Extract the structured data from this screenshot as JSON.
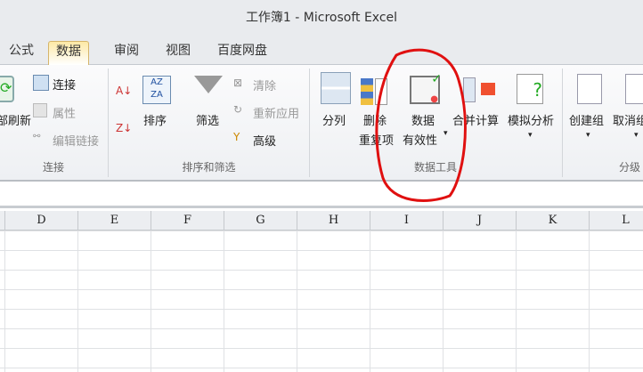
{
  "window": {
    "title": "工作簿1 - Microsoft Excel"
  },
  "tabs": [
    {
      "label": "公式"
    },
    {
      "label": "数据",
      "active": true
    },
    {
      "label": "审阅"
    },
    {
      "label": "视图"
    },
    {
      "label": "百度网盘"
    }
  ],
  "ribbon": {
    "connections": {
      "refresh": "部刷新",
      "connect": "连接",
      "properties": "属性",
      "edit_links": "编辑链接",
      "group": "连接"
    },
    "sort_filter": {
      "sort": "排序",
      "filter": "筛选",
      "clear": "清除",
      "reapply": "重新应用",
      "advanced": "高级",
      "group": "排序和筛选"
    },
    "data_tools": {
      "text_to_columns": "分列",
      "remove_dup_1": "删除",
      "remove_dup_2": "重复项",
      "validation_1": "数据",
      "validation_2": "有效性",
      "consolidate": "合并计算",
      "what_if": "模拟分析",
      "group": "数据工具"
    },
    "outline": {
      "group_btn": "创建组",
      "ungroup": "取消组合",
      "group": "分级"
    }
  },
  "columns": [
    "D",
    "E",
    "F",
    "G",
    "H",
    "I",
    "J",
    "K",
    "L"
  ],
  "annotation_color": "#e01010"
}
